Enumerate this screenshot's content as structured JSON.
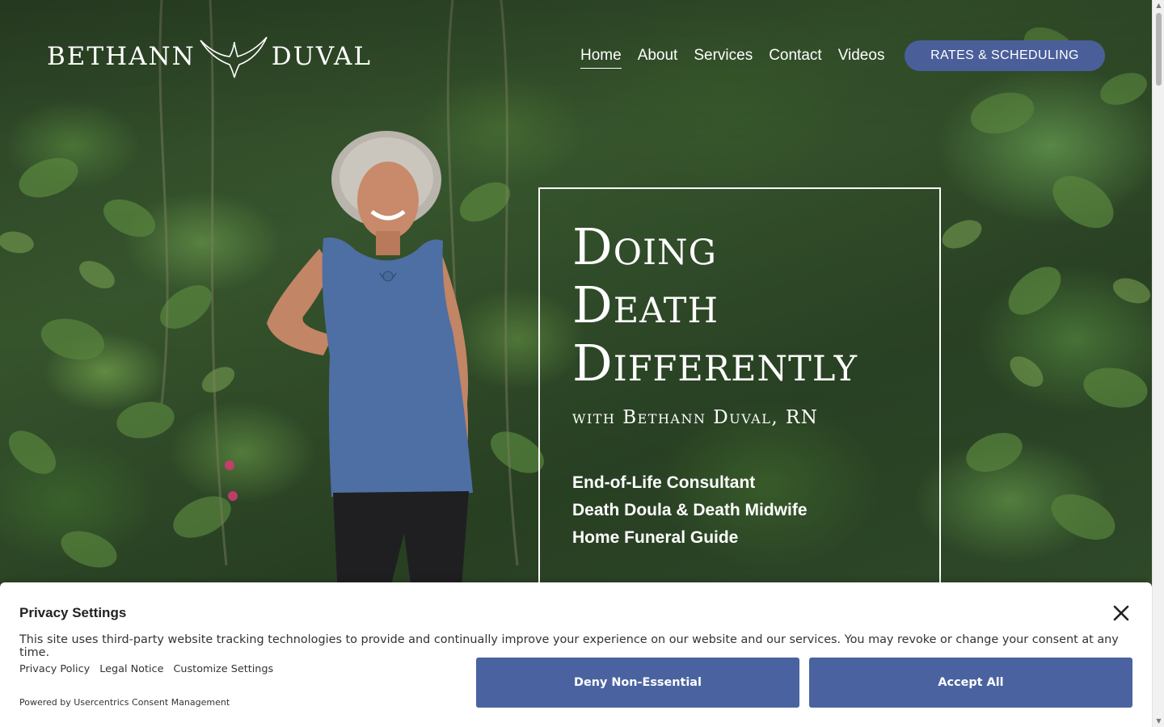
{
  "header": {
    "logo_left": "BETHANN",
    "logo_right": "DUVAL",
    "nav": [
      {
        "label": "Home",
        "active": true
      },
      {
        "label": "About"
      },
      {
        "label": "Services"
      },
      {
        "label": "Contact"
      },
      {
        "label": "Videos"
      }
    ],
    "cta_label": "RATES & SCHEDULING"
  },
  "hero": {
    "headline_lines": [
      "Doing",
      "Death",
      "Differently"
    ],
    "subhead": "with Bethann Duval, RN",
    "roles": [
      "End-of-Life Consultant",
      "Death Doula & Death Midwife",
      "Home Funeral Guide"
    ]
  },
  "consent": {
    "title": "Privacy Settings",
    "text": "This site uses third-party website tracking technologies to provide and continually improve your experience on our website and our services. You may revoke or change your consent at any time.",
    "links": [
      "Privacy Policy",
      "Legal Notice",
      "Customize Settings"
    ],
    "powered_by": "Powered by Usercentrics Consent Management",
    "deny_label": "Deny Non-Essential",
    "accept_label": "Accept All"
  },
  "colors": {
    "accent": "#4a5f9a",
    "consent_button": "#4a63a0"
  },
  "icons": {
    "logo_mark": "whale-tail-icon",
    "close": "close-icon"
  }
}
